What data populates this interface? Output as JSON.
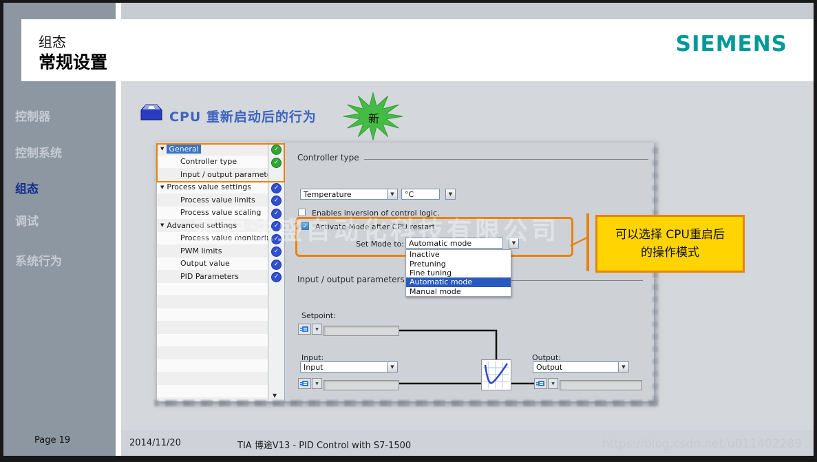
{
  "slide": {
    "pretitle": "组态",
    "title": "常规设置",
    "logo": "SIEMENS",
    "nav": [
      {
        "label": "控制器",
        "active": false
      },
      {
        "label": "控制系统",
        "active": false
      },
      {
        "label": "组态",
        "active": true
      },
      {
        "label": "调试",
        "active": false
      },
      {
        "label": "系统行为",
        "active": false
      }
    ],
    "heading": {
      "text": "CPU 重新启动后的行为",
      "badge": "新"
    },
    "callout": {
      "line1": "可以选择 CPU重启后",
      "line2": "的操作模式"
    },
    "footer": {
      "page": "Page 19",
      "date": "2014/11/20",
      "deck": "TIA 博途V13 - PID Control with S7-1500"
    },
    "watermark": {
      "center": "泰安法盛自动化科技有限公司",
      "url": "https://blog.csdn.net/u011402289"
    },
    "colors": {
      "accent_orange": "#E8820D",
      "siemens_teal": "#009999",
      "callout_yellow": "#FFD400",
      "star_green": "#44BB44",
      "check_green": "#2FA833",
      "check_blue": "#3050D0",
      "selection_blue": "#2A5AC0",
      "heading_blue": "#3C64C0"
    }
  },
  "tia": {
    "tree": [
      {
        "label": "General",
        "level": 0,
        "caret": true,
        "status": "green",
        "selected": true
      },
      {
        "label": "Controller type",
        "level": 1,
        "caret": false,
        "status": "green",
        "selected": false
      },
      {
        "label": "Input / output parameters",
        "level": 1,
        "caret": false,
        "status": "none",
        "selected": false
      },
      {
        "label": "Process value settings",
        "level": 0,
        "caret": true,
        "status": "blue",
        "selected": false
      },
      {
        "label": "Process value limits",
        "level": 1,
        "caret": false,
        "status": "blue",
        "selected": false
      },
      {
        "label": "Process value scaling",
        "level": 1,
        "caret": false,
        "status": "blue",
        "selected": false
      },
      {
        "label": "Advanced settings",
        "level": 0,
        "caret": true,
        "status": "blue",
        "selected": false
      },
      {
        "label": "Process value monitoring",
        "level": 1,
        "caret": false,
        "status": "blue",
        "selected": false
      },
      {
        "label": "PWM limits",
        "level": 1,
        "caret": false,
        "status": "blue",
        "selected": false
      },
      {
        "label": "Output value",
        "level": 1,
        "caret": false,
        "status": "blue",
        "selected": false
      },
      {
        "label": "PID Parameters",
        "level": 1,
        "caret": false,
        "status": "blue",
        "selected": false
      }
    ],
    "panel": {
      "section1": "Controller type",
      "controller_type": "Temperature",
      "unit": "°C",
      "checkbox_invert": "Enables inversion of control logic.",
      "checkbox_activate": "Activate Mode after CPU restart",
      "set_mode_label": "Set Mode to:",
      "set_mode_value": "Automatic mode",
      "mode_options": [
        "Inactive",
        "Pretuning",
        "Fine tuning",
        "Automatic mode",
        "Manual mode"
      ],
      "mode_selected": "Automatic mode",
      "section2": "Input / output parameters",
      "setpoint_label": "Setpoint:",
      "input_label": "Input:",
      "input_value": "Input",
      "output_label": "Output:",
      "output_value": "Output"
    }
  }
}
